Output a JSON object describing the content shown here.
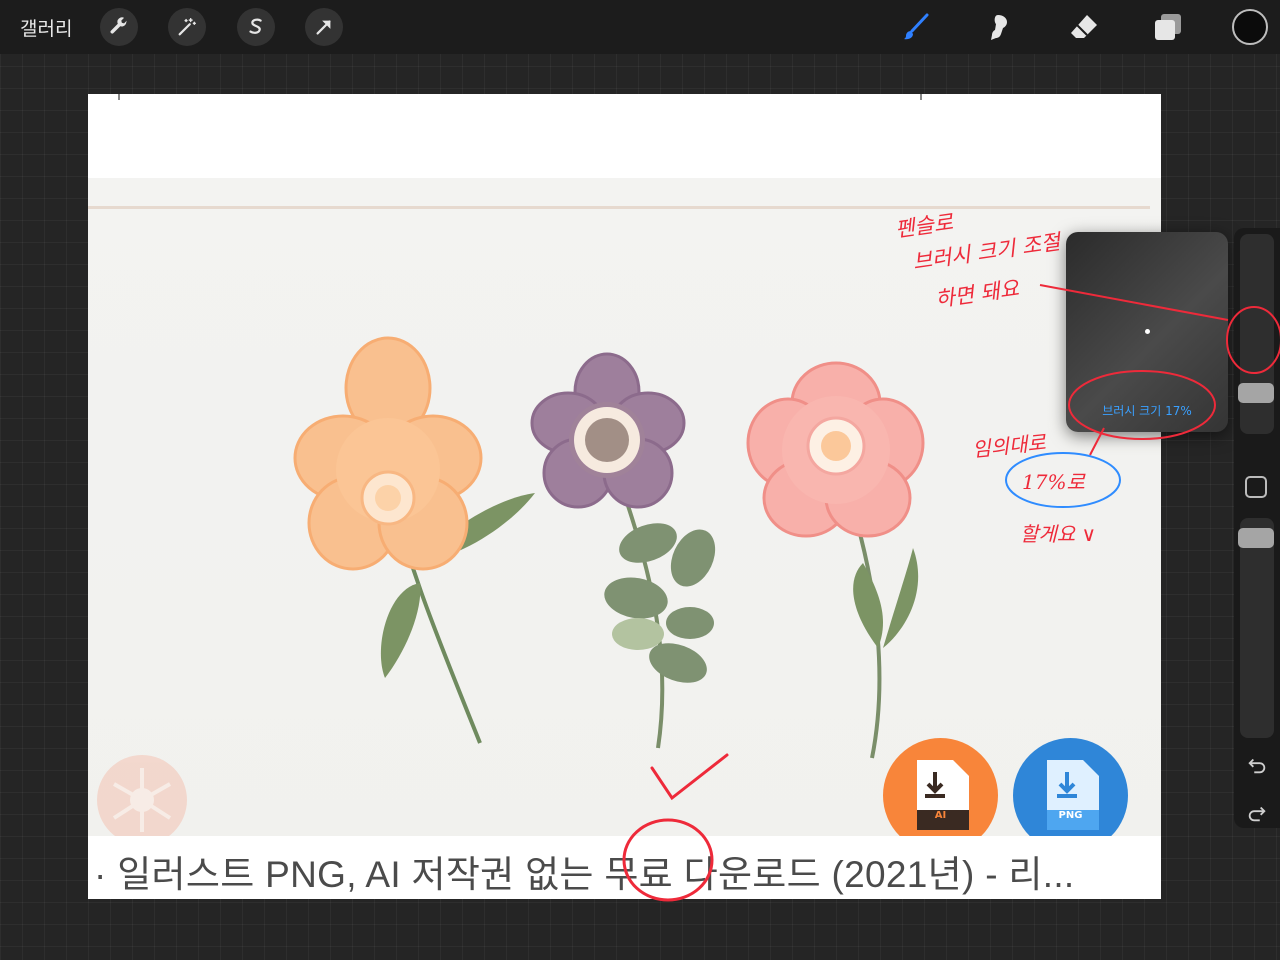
{
  "toolbar": {
    "gallery_label": "갤러리",
    "left_tools": [
      "wrench-icon",
      "magic-wand-icon",
      "selection-s-icon",
      "transform-arrow-icon"
    ],
    "right_tools": [
      "brush-icon",
      "smudge-icon",
      "eraser-icon",
      "layers-icon"
    ],
    "active_tool": "brush-icon",
    "active_color": "#0b0b0b",
    "accent_color": "#2f80ff"
  },
  "canvas": {
    "caption": {
      "before": "· 일러스트 PNG, AI 저작권 없는 ",
      "highlight": "무료",
      "after": " 다운로드 (2021년) - 리..."
    },
    "download_badges": [
      "AI",
      "PNG"
    ]
  },
  "brush_popup": {
    "label": "브러시 크기 17%"
  },
  "sidebar": {
    "brush_size_level": 0.17,
    "opacity_level": 0.95
  },
  "annotations": {
    "note_top": [
      "펜슬로",
      "브러시 크기 조절",
      "하면 돼요"
    ],
    "note_mid": [
      "임의대로",
      "17%로",
      "할게요 ∨"
    ],
    "color": "#ee2a3a",
    "circle_color": "#2f8cff"
  }
}
